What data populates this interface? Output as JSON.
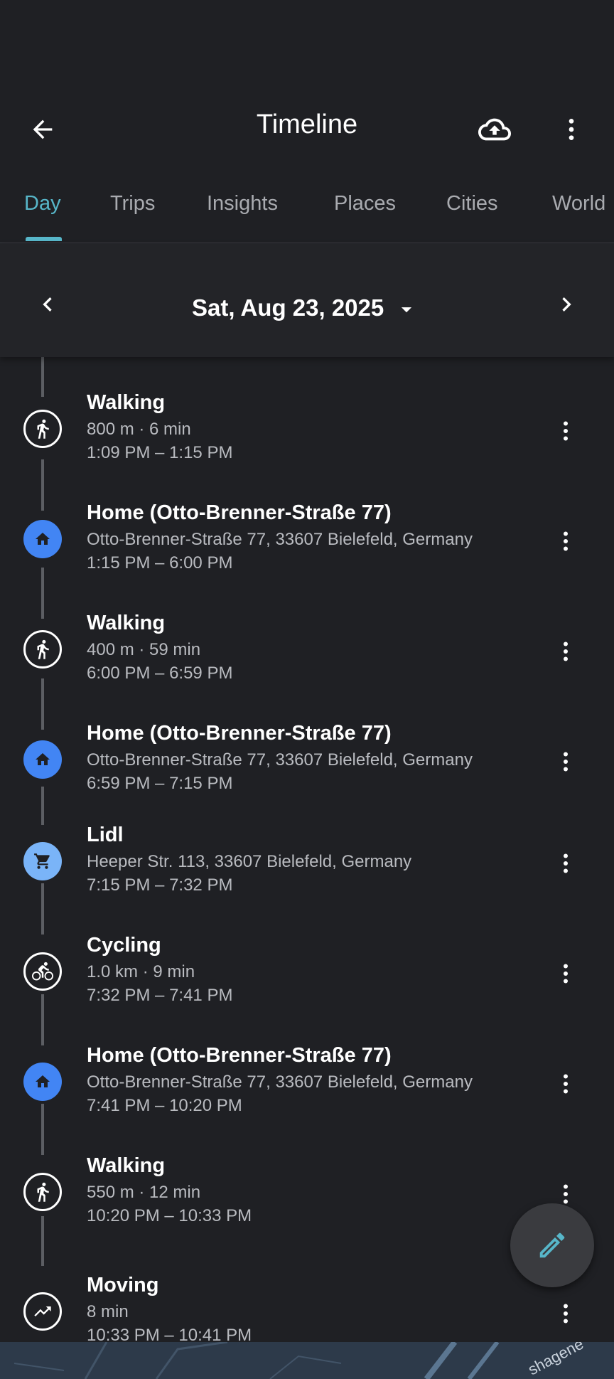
{
  "app": {
    "title": "Timeline"
  },
  "tabs": [
    {
      "label": "Day",
      "active": true
    },
    {
      "label": "Trips",
      "active": false
    },
    {
      "label": "Insights",
      "active": false
    },
    {
      "label": "Places",
      "active": false
    },
    {
      "label": "Cities",
      "active": false
    },
    {
      "label": "World",
      "active": false
    }
  ],
  "date": {
    "label": "Sat, Aug 23, 2025"
  },
  "timeline": [
    {
      "type": "activity",
      "icon": "walking-icon",
      "name": "Walking",
      "sub": "800 m · 6 min",
      "time": "1:09 PM – 1:15 PM"
    },
    {
      "type": "place",
      "icon": "home-icon",
      "name": "Home (Otto-Brenner-Straße 77)",
      "sub": "Otto-Brenner-Straße 77, 33607 Bielefeld, Germany",
      "time": "1:15 PM – 6:00 PM"
    },
    {
      "type": "activity",
      "icon": "walking-icon",
      "name": "Walking",
      "sub": "400 m · 59 min",
      "time": "6:00 PM – 6:59 PM"
    },
    {
      "type": "place",
      "icon": "home-icon",
      "name": "Home (Otto-Brenner-Straße 77)",
      "sub": "Otto-Brenner-Straße 77, 33607 Bielefeld, Germany",
      "time": "6:59 PM – 7:15 PM"
    },
    {
      "type": "place",
      "icon": "shopping-cart-icon",
      "name": "Lidl",
      "sub": "Heeper Str. 113, 33607 Bielefeld, Germany",
      "time": "7:15 PM – 7:32 PM"
    },
    {
      "type": "activity",
      "icon": "cycling-icon",
      "name": "Cycling",
      "sub": "1.0 km · 9 min",
      "time": "7:32 PM – 7:41 PM"
    },
    {
      "type": "place",
      "icon": "home-icon",
      "name": "Home (Otto-Brenner-Straße 77)",
      "sub": "Otto-Brenner-Straße 77, 33607 Bielefeld, Germany",
      "time": "7:41 PM – 10:20 PM"
    },
    {
      "type": "activity",
      "icon": "walking-icon",
      "name": "Walking",
      "sub": "550 m · 12 min",
      "time": "10:20 PM – 10:33 PM"
    },
    {
      "type": "activity",
      "icon": "moving-icon",
      "name": "Moving",
      "sub": "8 min",
      "time": "10:33 PM – 10:41 PM"
    }
  ],
  "map": {
    "label": "shagene"
  },
  "colors": {
    "accent": "#57b6c9",
    "place": "#4285f4",
    "background": "#1f2024"
  }
}
